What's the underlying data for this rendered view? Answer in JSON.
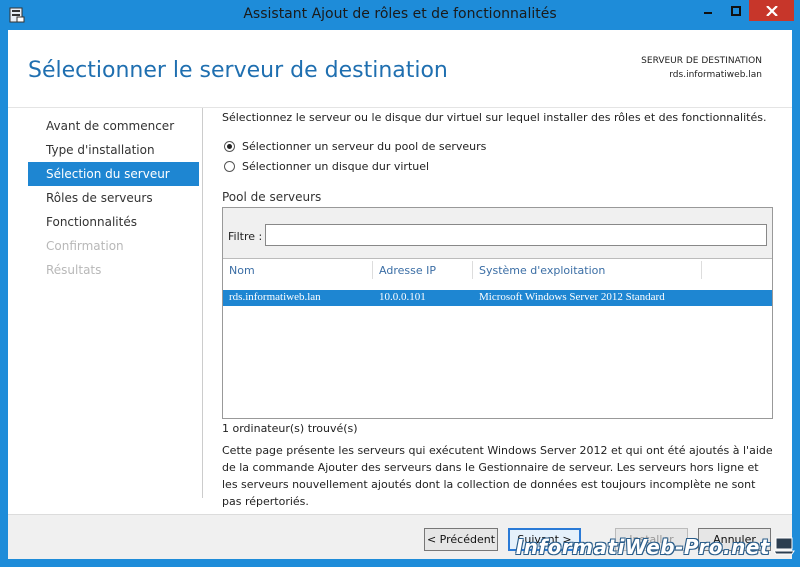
{
  "window": {
    "title": "Assistant Ajout de rôles et de fonctionnalités",
    "accent": "#1e8cd9",
    "close_color": "#c7362a"
  },
  "header": {
    "page_title": "Sélectionner le serveur de destination",
    "dest_label": "SERVEUR DE DESTINATION",
    "dest_server": "rds.informatiweb.lan"
  },
  "nav": {
    "items": [
      {
        "label": "Avant de commencer",
        "state": "normal"
      },
      {
        "label": "Type d'installation",
        "state": "normal"
      },
      {
        "label": "Sélection du serveur",
        "state": "selected"
      },
      {
        "label": "Rôles de serveurs",
        "state": "normal"
      },
      {
        "label": "Fonctionnalités",
        "state": "normal"
      },
      {
        "label": "Confirmation",
        "state": "disabled"
      },
      {
        "label": "Résultats",
        "state": "disabled"
      }
    ]
  },
  "content": {
    "intro": "Sélectionnez le serveur ou le disque dur virtuel sur lequel installer des rôles et des fonctionnalités.",
    "radio_pool": "Sélectionner un serveur du pool de serveurs",
    "radio_vhd": "Sélectionner un disque dur virtuel",
    "pool_label": "Pool de serveurs",
    "filter_label": "Filtre :",
    "filter_value": "",
    "columns": [
      "Nom",
      "Adresse IP",
      "Système d'exploitation"
    ],
    "rows": [
      {
        "name": "rds.informatiweb.lan",
        "ip": "10.0.0.101",
        "os": "Microsoft Windows Server 2012 Standard"
      }
    ],
    "count": "1 ordinateur(s) trouvé(s)",
    "description": "Cette page présente les serveurs qui exécutent Windows Server 2012 et qui ont été ajoutés à l'aide de la commande Ajouter des serveurs dans le Gestionnaire de serveur. Les serveurs hors ligne et les serveurs nouvellement ajoutés dont la collection de données est toujours incomplète ne sont pas répertoriés."
  },
  "footer": {
    "prev": "< Précédent",
    "next": "Suivant >",
    "install": "Installer",
    "cancel": "Annuler"
  },
  "watermark": "InformatiWeb-Pro.net"
}
